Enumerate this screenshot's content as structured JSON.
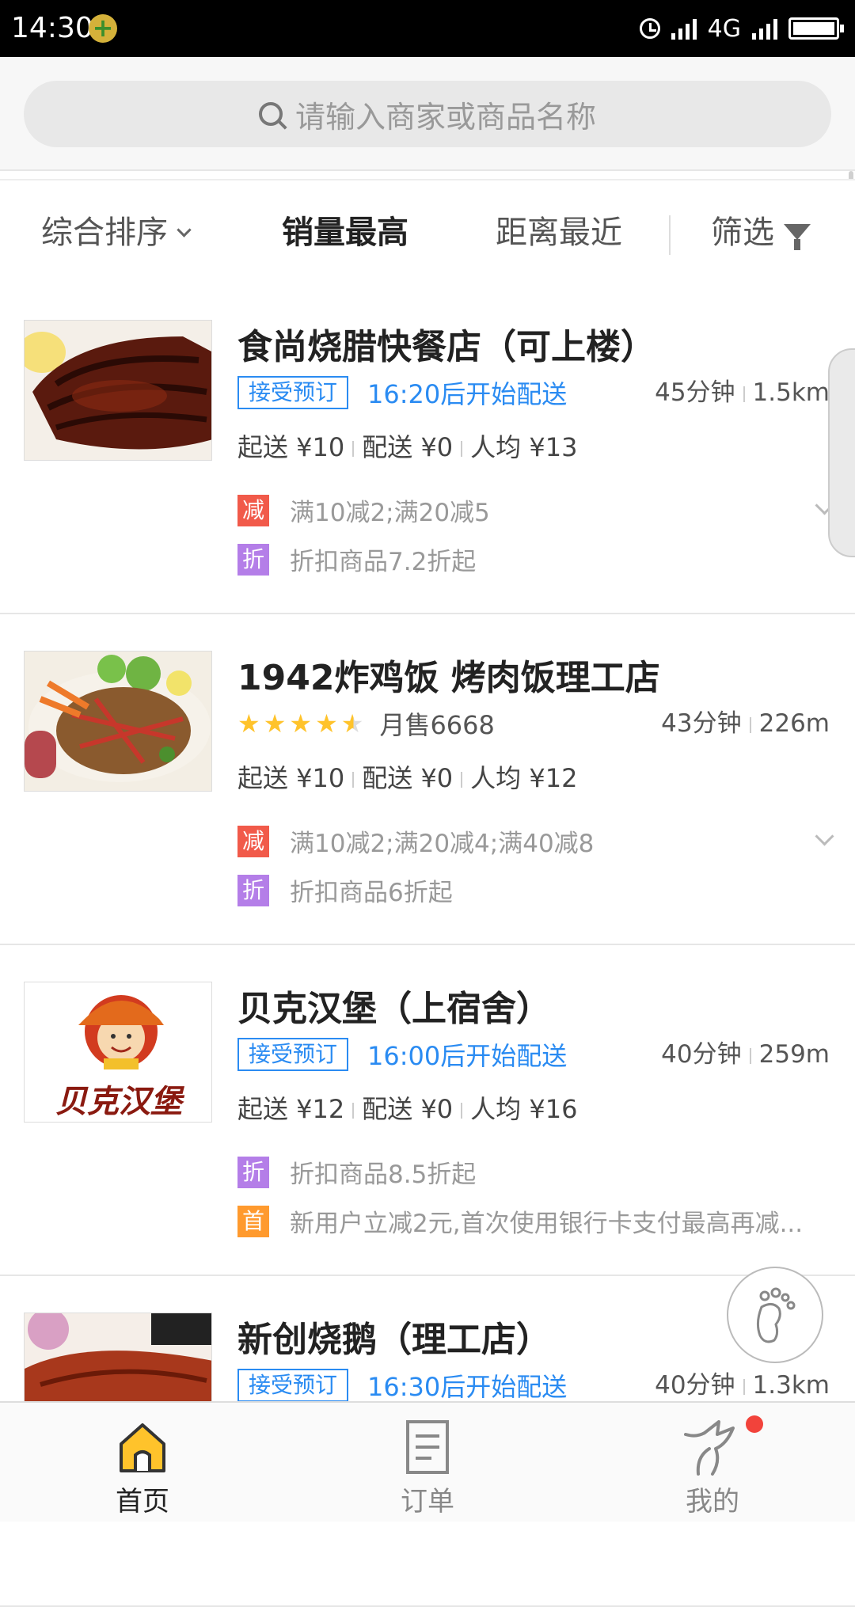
{
  "status_bar": {
    "time": "14:30",
    "network": "4G"
  },
  "search": {
    "placeholder": "请输入商家或商品名称"
  },
  "sort_tabs": [
    {
      "label": "综合排序"
    },
    {
      "label": "销量最高"
    },
    {
      "label": "距离最近"
    },
    {
      "label": "筛选"
    }
  ],
  "shops": [
    {
      "name": "食尚烧腊快餐店（可上楼）",
      "reserve_tag": "接受预订",
      "delivery_start": "16:20后开始配送",
      "time": "45分钟",
      "distance": "1.5km",
      "min_order": "起送 ¥10",
      "delivery_fee": "配送 ¥0",
      "per_person": "人均 ¥13",
      "promos": [
        {
          "badge": "减",
          "text": "满10减2;满20减5"
        },
        {
          "badge": "折",
          "text": "折扣商品7.2折起"
        }
      ]
    },
    {
      "name": "1942炸鸡饭 烤肉饭理工店",
      "rating": 4.5,
      "monthly_sales": "月售6668",
      "time": "43分钟",
      "distance": "226m",
      "min_order": "起送 ¥10",
      "delivery_fee": "配送 ¥0",
      "per_person": "人均 ¥12",
      "promos": [
        {
          "badge": "减",
          "text": "满10减2;满20减4;满40减8"
        },
        {
          "badge": "折",
          "text": "折扣商品6折起"
        }
      ]
    },
    {
      "name": "贝克汉堡（上宿舍）",
      "logo_text": "贝克汉堡",
      "reserve_tag": "接受预订",
      "delivery_start": "16:00后开始配送",
      "time": "40分钟",
      "distance": "259m",
      "min_order": "起送 ¥12",
      "delivery_fee": "配送 ¥0",
      "per_person": "人均 ¥16",
      "promos": [
        {
          "badge": "折",
          "text": "折扣商品8.5折起"
        },
        {
          "badge": "首",
          "text": "新用户立减2元,首次使用银行卡支付最高再减..."
        }
      ]
    },
    {
      "name": "新创烧鹅（理工店）",
      "reserve_tag": "接受预订",
      "delivery_start": "16:30后开始配送",
      "time": "40分钟",
      "distance": "1.3km"
    }
  ],
  "bottom_nav": [
    {
      "label": "首页",
      "icon": "home-icon"
    },
    {
      "label": "订单",
      "icon": "orders-icon"
    },
    {
      "label": "我的",
      "icon": "profile-icon"
    }
  ],
  "colors": {
    "accent": "#2a8bf2",
    "home_active": "#ffc32b",
    "badge_red": "#f15a4a",
    "badge_purple": "#b47ee8",
    "badge_orange": "#ff9a2e"
  }
}
